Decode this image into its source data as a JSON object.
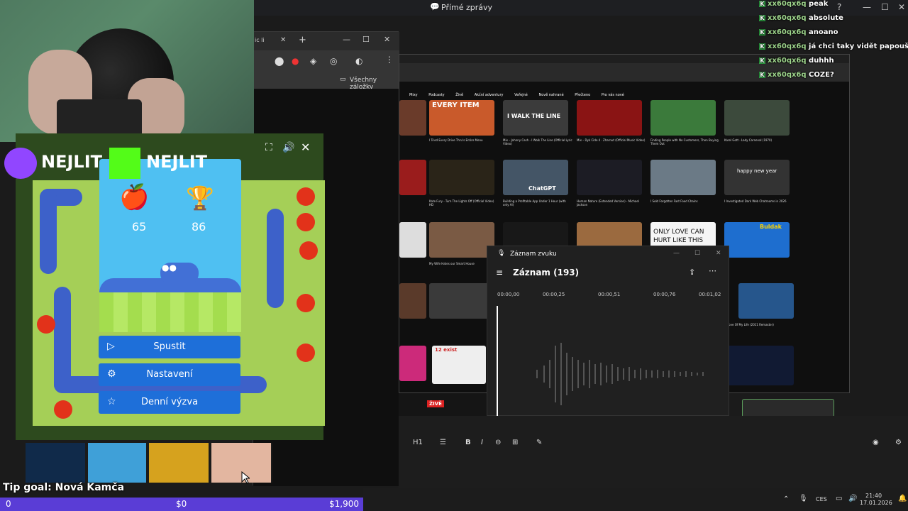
{
  "discord": {
    "title": "Přímé zprávy"
  },
  "chrome_left": {
    "bookmarks_label": "Všechny záložky"
  },
  "chat": {
    "lines": [
      {
        "user": "xx60qx6q",
        "msg": "peak"
      },
      {
        "user": "xx60qx6q",
        "msg": "absolute"
      },
      {
        "user": "xx60qx6q",
        "msg": "anoano"
      },
      {
        "user": "xx60qx6q",
        "msg": "já chci taky vidět papouškaaa"
      },
      {
        "user": "xx60qx6q",
        "msg": "duhhh"
      },
      {
        "user": "xx60qx6q",
        "msg": "COZE?"
      }
    ]
  },
  "youtube": {
    "chips": [
      "Mixy",
      "Podcasty",
      "Živě",
      "Akční adventury",
      "Veřejné",
      "Nově nahrané",
      "Přečteno",
      "Pro vás nové"
    ],
    "videos": [
      {
        "title": "I Tried Every Drive Thru's Entire Menu",
        "thumb_text": "EVERY ITEM"
      },
      {
        "title": "Mix – Johnny Cash - I Walk The Line (Official Lyric Video)",
        "thumb_text": "I WALK THE LINE"
      },
      {
        "title": "Mix – Dyk Cido 4 · Zharnut (Official Music Video)",
        "thumb_text": ""
      },
      {
        "title": "Finding People with No Customers, Then Buying Them Out",
        "thumb_text": ""
      },
      {
        "title": "Karel Gott · Lady Carneval (1970)",
        "thumb_text": ""
      },
      {
        "title": "Kate Fury - Turn The Lights Off (Official Video) HD",
        "thumb_text": ""
      },
      {
        "title": "Building a Profitable App Under 1 Hour (with only AI)",
        "thumb_text": "ChatGPT"
      },
      {
        "title": "Human Nature (Extended Version) - Michael Jackson",
        "thumb_text": ""
      },
      {
        "title": "I Sold Forgotten Fast Food Chains",
        "thumb_text": ""
      },
      {
        "title": "I Investigated Dark Web Chatrooms in 2026",
        "thumb_text": "happy new year"
      },
      {
        "title": "My Wife Hates our Smart House",
        "thumb_text": ""
      },
      {
        "title": "",
        "thumb_text": "ONLY LOVE CAN HURT LIKE THIS"
      },
      {
        "title": "",
        "thumb_text": "Buldak"
      },
      {
        "title": "Love Of My Life (2011 Remaster)",
        "thumb_text": ""
      },
      {
        "title": "",
        "thumb_text": "12 exist"
      },
      {
        "title": "",
        "thumb_text": "ŽIVĚ"
      }
    ]
  },
  "recorder": {
    "app_title": "Záznam zvuku",
    "recording_title": "Záznam (193)",
    "timeline": [
      "00:00,00",
      "00:00,25",
      "00:00,51",
      "00:00,76",
      "00:01,02"
    ]
  },
  "game": {
    "logo_left": "NEJLIT",
    "logo_right": "NEJLIT",
    "score": "65",
    "best": "86",
    "buttons": {
      "start": "Spustit",
      "settings": "Nastavení",
      "daily": "Denní výzva"
    }
  },
  "stream": {
    "tip_goal": "Tip goal: Nová Kamča",
    "progress_left": "0",
    "progress_mid": "$0",
    "progress_right": "$1,900"
  },
  "taskbar": {
    "lang": "CES",
    "time": "21:40",
    "date": "17.01.2026"
  },
  "editor": {
    "heading": "H1"
  },
  "colors": {
    "progress": "#5a3dd6",
    "game_button": "#1e6fd9",
    "board": "#a5cf57",
    "panel": "#4fc0f2",
    "snake": "#3d61c9"
  }
}
